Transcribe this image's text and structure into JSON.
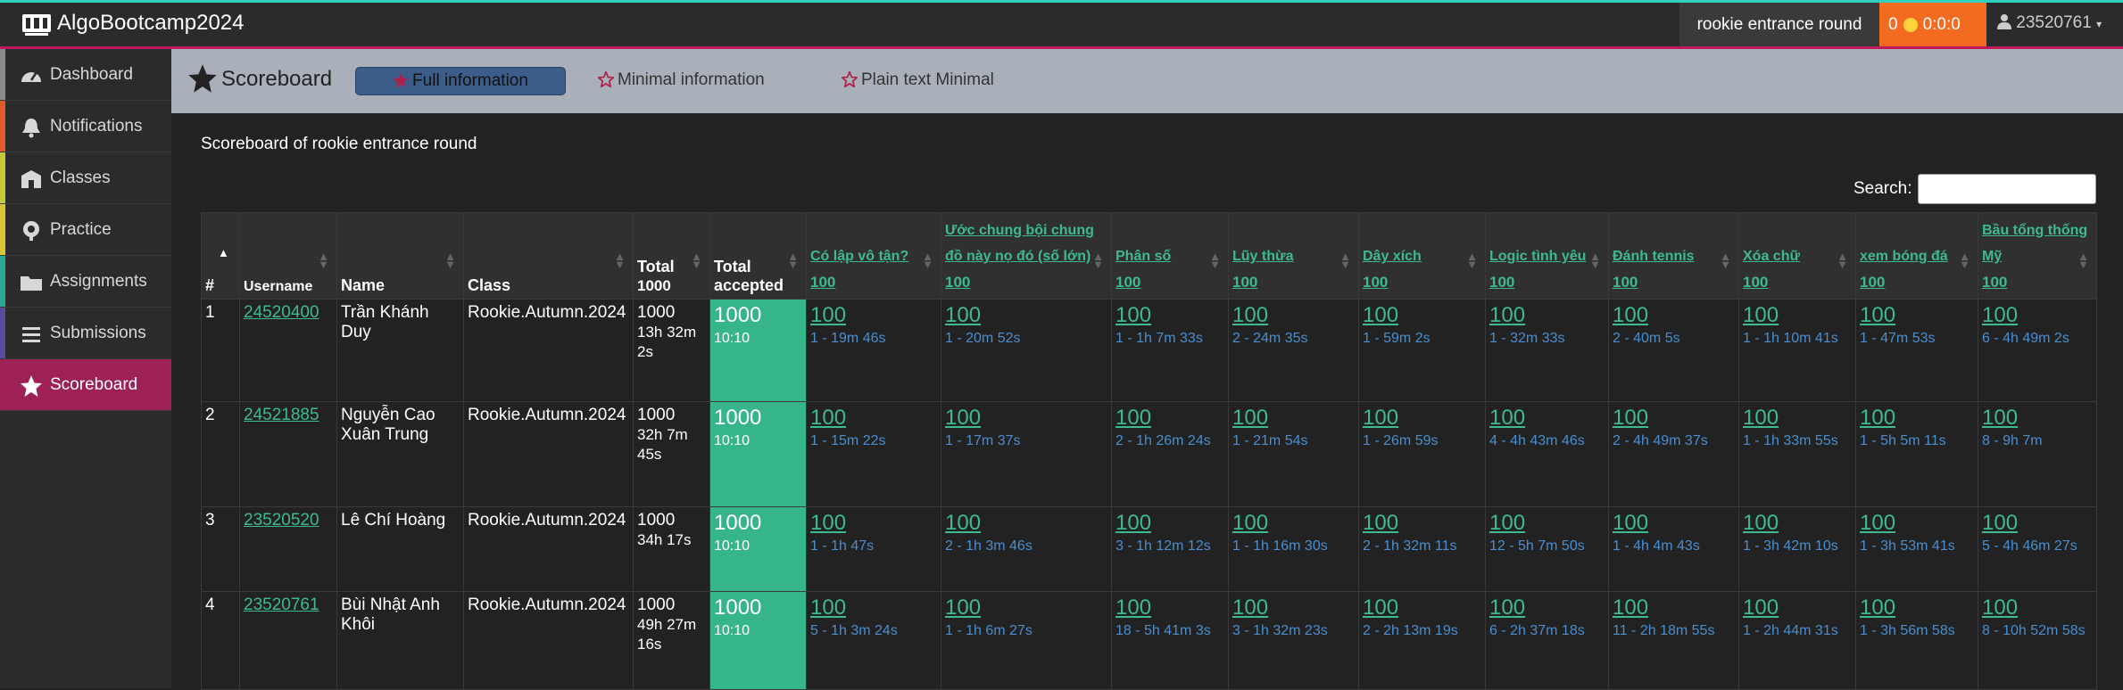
{
  "app": {
    "brand": "AlgoBootcamp2024",
    "round": "rookie entrance round",
    "score": "0",
    "timer": "0:0:0",
    "user": "23520761"
  },
  "sidebar": [
    {
      "label": "Dashboard",
      "icon": "dashboard-icon",
      "color": "#8a8a8a"
    },
    {
      "label": "Notifications",
      "icon": "bell-icon",
      "color": "#e05a2b"
    },
    {
      "label": "Classes",
      "icon": "classes-icon",
      "color": "#c8c93a"
    },
    {
      "label": "Practice",
      "icon": "practice-icon",
      "color": "#d9c634"
    },
    {
      "label": "Assignments",
      "icon": "folder-icon",
      "color": "#2aa89a"
    },
    {
      "label": "Submissions",
      "icon": "list-icon",
      "color": "#5a4a9a"
    },
    {
      "label": "Scoreboard",
      "icon": "star-icon",
      "color": "#9d2155",
      "active": true
    }
  ],
  "header": {
    "title": "Scoreboard",
    "tabs": [
      "Full information",
      "Minimal information",
      "Plain text Minimal"
    ]
  },
  "scoreboard": {
    "caption": "Scoreboard of rookie entrance round",
    "search_label": "Search:",
    "columns": {
      "rank": "#",
      "username": "Username",
      "name": "Name",
      "class": "Class",
      "total": "Total",
      "total_max": "1000",
      "accepted": "Total accepted"
    },
    "problems": [
      {
        "name": "Có lập vô tận?",
        "max": "100"
      },
      {
        "name": "Ước chung bội chung đồ này nọ đó (số lớn)",
        "max": "100"
      },
      {
        "name": "Phân số",
        "max": "100"
      },
      {
        "name": "Lũy thừa",
        "max": "100"
      },
      {
        "name": "Dây xích",
        "max": "100"
      },
      {
        "name": "Logic tình yêu",
        "max": "100"
      },
      {
        "name": "Đánh tennis",
        "max": "100"
      },
      {
        "name": "Xóa chữ",
        "max": "100"
      },
      {
        "name": "xem bóng đá",
        "max": "100"
      },
      {
        "name": "Bầu tổng thống Mỹ",
        "max": "100"
      }
    ],
    "rows": [
      {
        "rank": "1",
        "username": "24520400",
        "name": "Trần Khánh Duy",
        "class": "Rookie.Autumn.2024",
        "total": "1000",
        "total_time": "13h 32m 2s",
        "accepted": "1000",
        "accepted_time": "10:10",
        "cells": [
          [
            "100",
            "1 - 19m 46s"
          ],
          [
            "100",
            "1 - 20m 52s"
          ],
          [
            "100",
            "1 - 1h 7m 33s"
          ],
          [
            "100",
            "2 - 24m 35s"
          ],
          [
            "100",
            "1 - 59m 2s"
          ],
          [
            "100",
            "1 - 32m 33s"
          ],
          [
            "100",
            "2 - 40m 5s"
          ],
          [
            "100",
            "1 - 1h 10m 41s"
          ],
          [
            "100",
            "1 - 47m 53s"
          ],
          [
            "100",
            "6 - 4h 49m 2s"
          ]
        ]
      },
      {
        "rank": "2",
        "username": "24521885",
        "name": "Nguyễn Cao Xuân Trung",
        "class": "Rookie.Autumn.2024",
        "total": "1000",
        "total_time": "32h 7m 45s",
        "accepted": "1000",
        "accepted_time": "10:10",
        "cells": [
          [
            "100",
            "1 - 15m 22s"
          ],
          [
            "100",
            "1 - 17m 37s"
          ],
          [
            "100",
            "2 - 1h 26m 24s"
          ],
          [
            "100",
            "1 - 21m 54s"
          ],
          [
            "100",
            "1 - 26m 59s"
          ],
          [
            "100",
            "4 - 4h 43m 46s"
          ],
          [
            "100",
            "2 - 4h 49m 37s"
          ],
          [
            "100",
            "1 - 1h 33m 55s"
          ],
          [
            "100",
            "1 - 5h 5m 11s"
          ],
          [
            "100",
            "8 - 9h 7m"
          ]
        ]
      },
      {
        "rank": "3",
        "username": "23520520",
        "name": "Lê Chí Hoàng",
        "class": "Rookie.Autumn.2024",
        "total": "1000",
        "total_time": "34h 17s",
        "accepted": "1000",
        "accepted_time": "10:10",
        "cells": [
          [
            "100",
            "1 - 1h 47s"
          ],
          [
            "100",
            "2 - 1h 3m 46s"
          ],
          [
            "100",
            "3 - 1h 12m 12s"
          ],
          [
            "100",
            "1 - 1h 16m 30s"
          ],
          [
            "100",
            "2 - 1h 32m 11s"
          ],
          [
            "100",
            "12 - 5h 7m 50s"
          ],
          [
            "100",
            "1 - 4h 4m 43s"
          ],
          [
            "100",
            "1 - 3h 42m 10s"
          ],
          [
            "100",
            "1 - 3h 53m 41s"
          ],
          [
            "100",
            "5 - 4h 46m 27s"
          ]
        ]
      },
      {
        "rank": "4",
        "username": "23520761",
        "name": "Bùi Nhật Anh Khôi",
        "class": "Rookie.Autumn.2024",
        "total": "1000",
        "total_time": "49h 27m 16s",
        "accepted": "1000",
        "accepted_time": "10:10",
        "cells": [
          [
            "100",
            "5 - 1h 3m 24s"
          ],
          [
            "100",
            "1 - 1h 6m 27s"
          ],
          [
            "100",
            "18 - 5h 41m 3s"
          ],
          [
            "100",
            "3 - 1h 32m 23s"
          ],
          [
            "100",
            "2 - 2h 13m 19s"
          ],
          [
            "100",
            "6 - 2h 37m 18s"
          ],
          [
            "100",
            "11 - 2h 18m 55s"
          ],
          [
            "100",
            "1 - 2h 44m 31s"
          ],
          [
            "100",
            "1 - 3h 56m 58s"
          ],
          [
            "100",
            "8 - 10h 52m 58s"
          ]
        ]
      }
    ]
  }
}
